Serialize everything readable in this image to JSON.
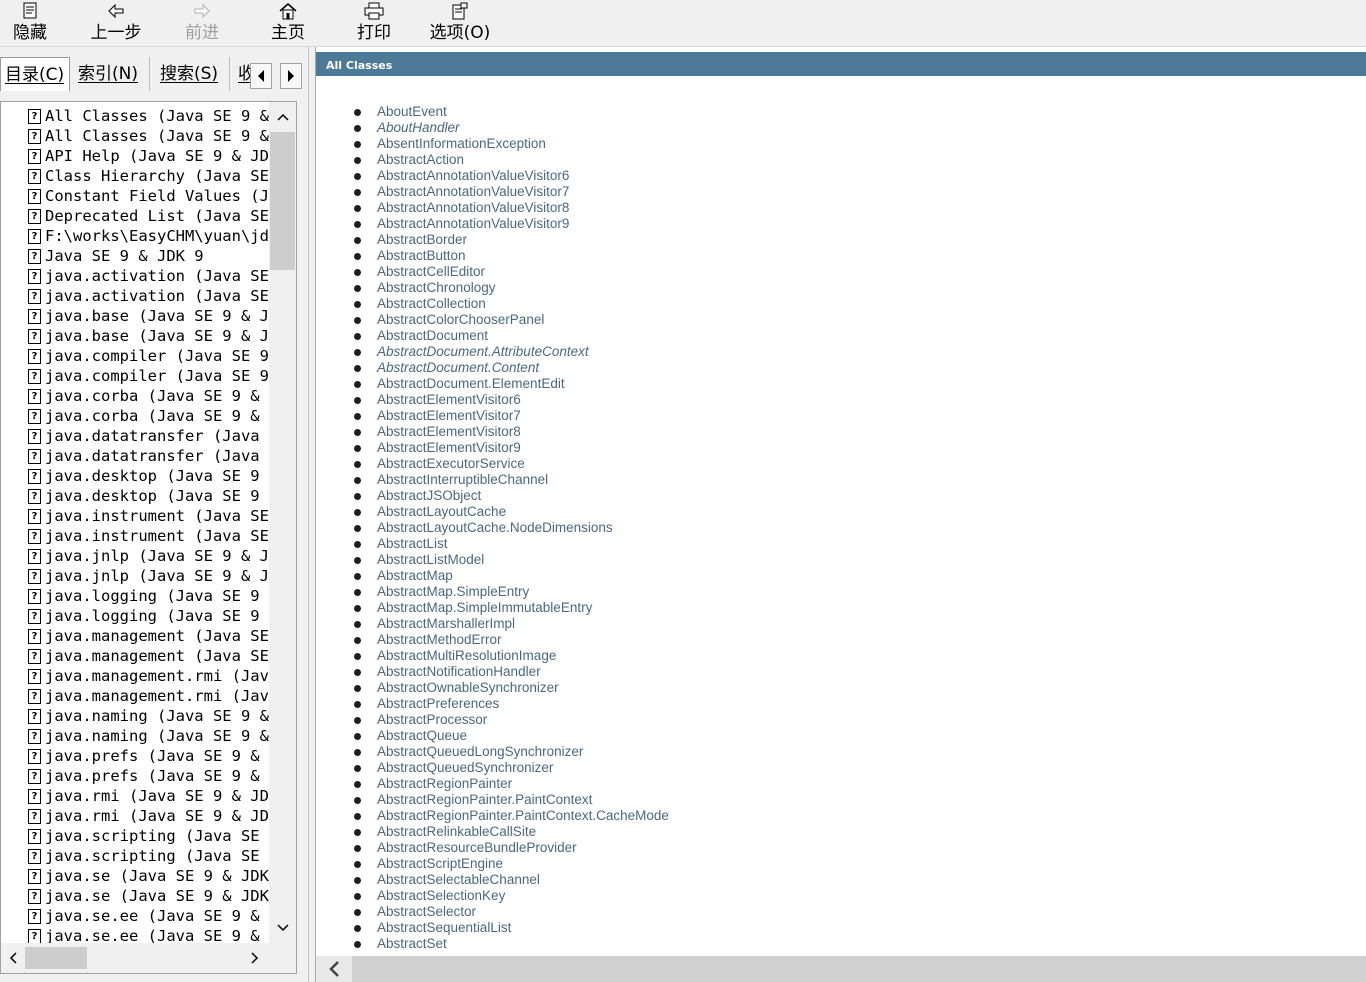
{
  "toolbar": {
    "buttons": [
      {
        "label": "隐藏",
        "icon": "hide-icon",
        "enabled": true
      },
      {
        "label": "上一步",
        "icon": "back-arrow-icon",
        "enabled": true
      },
      {
        "label": "前进",
        "icon": "forward-arrow-icon",
        "enabled": false
      },
      {
        "label": "主页",
        "icon": "home-icon",
        "enabled": true
      },
      {
        "label": "打印",
        "icon": "printer-icon",
        "enabled": true
      },
      {
        "label": "选项(O)",
        "icon": "options-icon",
        "enabled": true
      }
    ]
  },
  "nav": {
    "tabs": [
      "目录(C)",
      "索引(N)",
      "搜索(S)",
      "收"
    ],
    "active_tab": "目录(C)",
    "tree_items": [
      "All Classes (Java SE 9 &",
      "All Classes (Java SE 9 &",
      "API Help (Java SE 9 & JDK",
      "Class Hierarchy (Java SE",
      "Constant Field Values (Ja",
      "Deprecated List (Java SE",
      "F:\\works\\EasyCHM\\yuan\\jdk",
      "Java SE 9 & JDK 9",
      "java.activation (Java SE",
      "java.activation (Java SE",
      "java.base (Java SE 9 & JD",
      "java.base (Java SE 9 & JD",
      "java.compiler (Java SE 9",
      "java.compiler (Java SE 9",
      "java.corba (Java SE 9 & J",
      "java.corba (Java SE 9 & J",
      "java.datatransfer (Java S",
      "java.datatransfer (Java S",
      "java.desktop (Java SE 9 &",
      "java.desktop (Java SE 9 &",
      "java.instrument (Java SE",
      "java.instrument (Java SE",
      "java.jnlp (Java SE 9 & JD",
      "java.jnlp (Java SE 9 & JD",
      "java.logging (Java SE 9 &",
      "java.logging (Java SE 9 &",
      "java.management (Java SE",
      "java.management (Java SE",
      "java.management.rmi (Java",
      "java.management.rmi (Java",
      "java.naming (Java SE 9 &",
      "java.naming (Java SE 9 &",
      "java.prefs (Java SE 9 & J",
      "java.prefs (Java SE 9 & J",
      "java.rmi (Java SE 9 & JDK",
      "java.rmi (Java SE 9 & JDK",
      "java.scripting (Java SE 9",
      "java.scripting (Java SE 9",
      "java.se (Java SE 9 & JDK",
      "java.se (Java SE 9 & JDK",
      "java.se.ee (Java SE 9 & J",
      "java.se.ee (Java SE 9 & J"
    ]
  },
  "content": {
    "header": "All Classes",
    "classes": [
      {
        "name": "AboutEvent",
        "italic": false
      },
      {
        "name": "AboutHandler",
        "italic": true
      },
      {
        "name": "AbsentInformationException",
        "italic": false
      },
      {
        "name": "AbstractAction",
        "italic": false
      },
      {
        "name": "AbstractAnnotationValueVisitor6",
        "italic": false
      },
      {
        "name": "AbstractAnnotationValueVisitor7",
        "italic": false
      },
      {
        "name": "AbstractAnnotationValueVisitor8",
        "italic": false
      },
      {
        "name": "AbstractAnnotationValueVisitor9",
        "italic": false
      },
      {
        "name": "AbstractBorder",
        "italic": false
      },
      {
        "name": "AbstractButton",
        "italic": false
      },
      {
        "name": "AbstractCellEditor",
        "italic": false
      },
      {
        "name": "AbstractChronology",
        "italic": false
      },
      {
        "name": "AbstractCollection",
        "italic": false
      },
      {
        "name": "AbstractColorChooserPanel",
        "italic": false
      },
      {
        "name": "AbstractDocument",
        "italic": false
      },
      {
        "name": "AbstractDocument.AttributeContext",
        "italic": true
      },
      {
        "name": "AbstractDocument.Content",
        "italic": true
      },
      {
        "name": "AbstractDocument.ElementEdit",
        "italic": false
      },
      {
        "name": "AbstractElementVisitor6",
        "italic": false
      },
      {
        "name": "AbstractElementVisitor7",
        "italic": false
      },
      {
        "name": "AbstractElementVisitor8",
        "italic": false
      },
      {
        "name": "AbstractElementVisitor9",
        "italic": false
      },
      {
        "name": "AbstractExecutorService",
        "italic": false
      },
      {
        "name": "AbstractInterruptibleChannel",
        "italic": false
      },
      {
        "name": "AbstractJSObject",
        "italic": false
      },
      {
        "name": "AbstractLayoutCache",
        "italic": false
      },
      {
        "name": "AbstractLayoutCache.NodeDimensions",
        "italic": false
      },
      {
        "name": "AbstractList",
        "italic": false
      },
      {
        "name": "AbstractListModel",
        "italic": false
      },
      {
        "name": "AbstractMap",
        "italic": false
      },
      {
        "name": "AbstractMap.SimpleEntry",
        "italic": false
      },
      {
        "name": "AbstractMap.SimpleImmutableEntry",
        "italic": false
      },
      {
        "name": "AbstractMarshallerImpl",
        "italic": false
      },
      {
        "name": "AbstractMethodError",
        "italic": false
      },
      {
        "name": "AbstractMultiResolutionImage",
        "italic": false
      },
      {
        "name": "AbstractNotificationHandler",
        "italic": false
      },
      {
        "name": "AbstractOwnableSynchronizer",
        "italic": false
      },
      {
        "name": "AbstractPreferences",
        "italic": false
      },
      {
        "name": "AbstractProcessor",
        "italic": false
      },
      {
        "name": "AbstractQueue",
        "italic": false
      },
      {
        "name": "AbstractQueuedLongSynchronizer",
        "italic": false
      },
      {
        "name": "AbstractQueuedSynchronizer",
        "italic": false
      },
      {
        "name": "AbstractRegionPainter",
        "italic": false
      },
      {
        "name": "AbstractRegionPainter.PaintContext",
        "italic": false
      },
      {
        "name": "AbstractRegionPainter.PaintContext.CacheMode",
        "italic": false
      },
      {
        "name": "AbstractRelinkableCallSite",
        "italic": false
      },
      {
        "name": "AbstractResourceBundleProvider",
        "italic": false
      },
      {
        "name": "AbstractScriptEngine",
        "italic": false
      },
      {
        "name": "AbstractSelectableChannel",
        "italic": false
      },
      {
        "name": "AbstractSelectionKey",
        "italic": false
      },
      {
        "name": "AbstractSelector",
        "italic": false
      },
      {
        "name": "AbstractSequentialList",
        "italic": false
      },
      {
        "name": "AbstractSet",
        "italic": false
      }
    ]
  },
  "colors": {
    "header_bar": "#4d7a97",
    "link": "#4a6782"
  }
}
